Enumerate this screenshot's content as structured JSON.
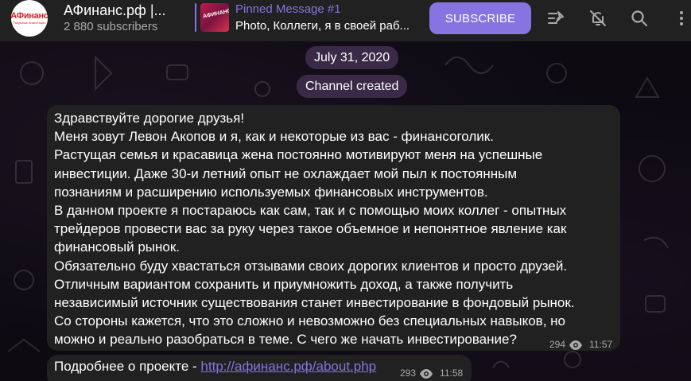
{
  "header": {
    "avatar_text": "АФинанс",
    "avatar_sub": "Разумные инвестиции",
    "title": "АФинанс.рф |...",
    "subscribers": "2 880 subscribers",
    "pinned_label": "Pinned Message #1",
    "pinned_thumb_text": "АФИНАНС",
    "pinned_text": "Photo, Коллеги, я в своей раб...",
    "subscribe_label": "SUBSCRIBE",
    "icons": [
      "pin-list-icon",
      "mute-icon",
      "search-icon",
      "more-vertical-icon"
    ]
  },
  "service": {
    "date": "July 31, 2020",
    "created": "Channel created"
  },
  "messages": [
    {
      "lines": [
        "Здравствуйте дорогие друзья!",
        "Меня зовут Левон Акопов и я, как и некоторые из вас - финансоголик.",
        "Растущая семья и красавица жена постоянно мотивируют меня на успешные",
        "инвестиции. Даже 30-и летний опыт не охлаждает мой пыл к постоянным",
        "познаниям и расширению используемых финансовых инструментов.",
        "В данном проекте я постараюсь как сам, так и с помощью моих коллег - опытных",
        "трейдеров провести вас за руку через такое объемное и непонятное явление как",
        "финансовый рынок.",
        "Обязательно буду хвастаться отзывами своих дорогих клиентов и просто друзей.",
        "Отличным вариантом сохранить и приумножить доход, а также получить",
        "независимый источник существования станет инвестирование в фондовый рынок.",
        "Со стороны кажется, что это сложно и невозможно без специальных навыков, но",
        "можно и реально разобраться в теме. С чего же начать инвестирование?"
      ],
      "views": "294",
      "time": "11:57"
    },
    {
      "text": "Подробнее о проекте - ",
      "link": "http://афинанс.рф/about.php",
      "views": "293",
      "time": "11:58"
    }
  ],
  "colors": {
    "accent": "#8774e1",
    "header_bg": "#212121",
    "bubble_bg": "#212121",
    "pill_bg": "#3a2a47",
    "logo_red": "#d21f28"
  }
}
